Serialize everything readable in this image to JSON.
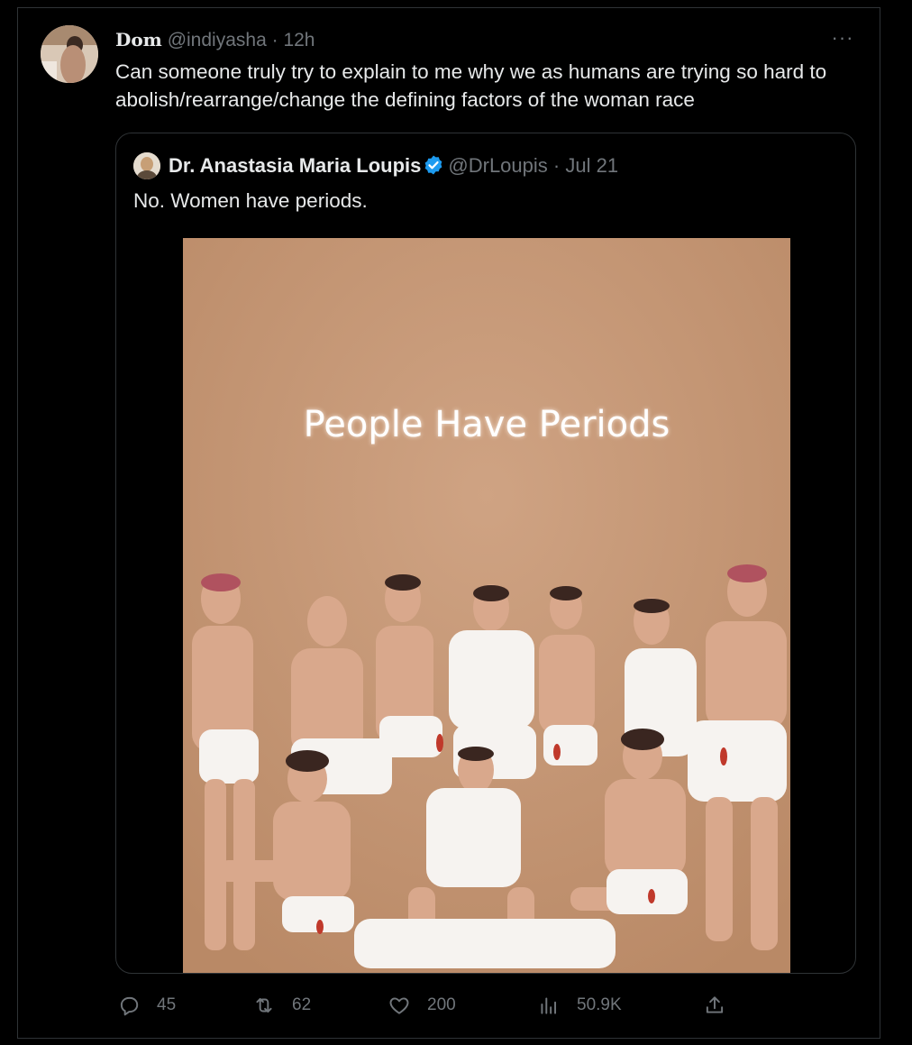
{
  "tweet": {
    "author_name": "Dom",
    "author_handle": "@indiyasha",
    "separator": "·",
    "time": "12h",
    "more_label": "···",
    "text": "Can someone truly try to explain to me why we  as humans are trying so hard to abolish/rearrange/change the defining factors of the woman race"
  },
  "quote": {
    "author_name": "Dr. Anastasia Maria Loupis",
    "author_handle": "@DrLoupis",
    "separator": "·",
    "date": "Jul 21",
    "verified": true,
    "text": "No. Women have periods.",
    "image": {
      "background_color": "#c69a78",
      "headline": "People Have Periods"
    }
  },
  "actions": {
    "replies": "45",
    "reposts": "62",
    "likes": "200",
    "views": "50.9K"
  },
  "icons": {
    "reply": "reply-icon",
    "repost": "repost-icon",
    "like": "heart-icon",
    "views": "views-icon",
    "share": "share-icon",
    "verified": "verified-badge-icon"
  },
  "colors": {
    "background": "#000000",
    "text": "#e7e9ea",
    "muted": "#71767b",
    "border": "#2f3336",
    "verified": "#1d9bf0"
  }
}
